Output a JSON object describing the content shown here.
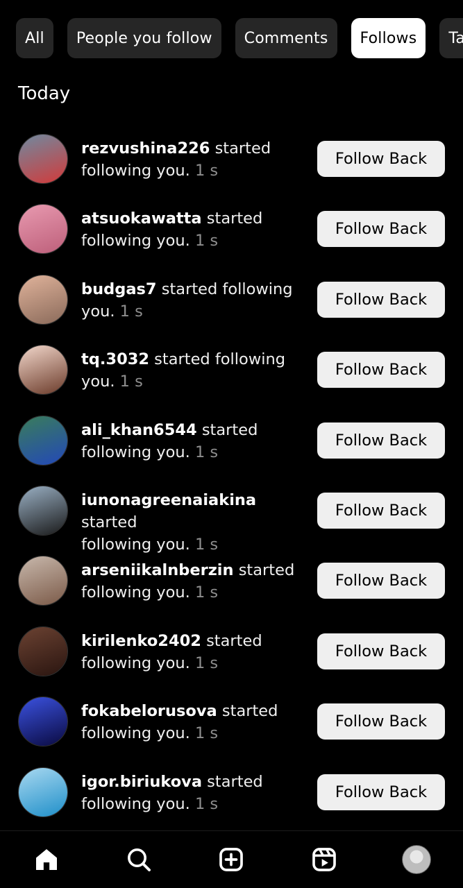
{
  "filters": [
    "All",
    "People you follow",
    "Comments",
    "Follows",
    "Ta"
  ],
  "active_filter_index": 3,
  "section": {
    "title": "Today"
  },
  "items": [
    {
      "username": "rezvushina226",
      "line1_rest": " started",
      "line2": "following you.",
      "time": " 1 s",
      "button": "Follow Back",
      "avatar_colors": [
        "#6f8aa0",
        "#d23a3a"
      ]
    },
    {
      "username": "atsuokawatta",
      "line1_rest": " started",
      "line2": "following you.",
      "time": " 1 s",
      "button": "Follow Back",
      "avatar_colors": [
        "#e89ab0",
        "#bd5f7a"
      ]
    },
    {
      "username": "budgas7",
      "line1_rest": " started following",
      "line2": "you.",
      "time": " 1 s",
      "button": "Follow Back",
      "avatar_colors": [
        "#e0b39b",
        "#8a6a5a"
      ]
    },
    {
      "username": "tq.3032",
      "line1_rest": " started following",
      "line2": "you.",
      "time": " 1 s",
      "button": "Follow Back",
      "avatar_colors": [
        "#f2d7cb",
        "#6b3b2a"
      ]
    },
    {
      "username": "ali_khan6544",
      "line1_rest": " started",
      "line2": "following you.",
      "time": " 1 s",
      "button": "Follow Back",
      "avatar_colors": [
        "#3a7d5a",
        "#2348b8"
      ]
    },
    {
      "username": "iunonagreenaiakina",
      "line1_rest": " started",
      "line2": "following you.",
      "time": " 1 s",
      "button": "Follow Back",
      "avatar_colors": [
        "#9ab0c4",
        "#1a1a1a"
      ]
    },
    {
      "username": "arseniikalnberzin",
      "line1_rest": " started",
      "line2": "following you.",
      "time": " 1 s",
      "button": "Follow Back",
      "avatar_colors": [
        "#c8b8ac",
        "#7b5a48"
      ]
    },
    {
      "username": "kirilenko2402",
      "line1_rest": " started",
      "line2": "following you.",
      "time": " 1 s",
      "button": "Follow Back",
      "avatar_colors": [
        "#6b4232",
        "#2a1510"
      ]
    },
    {
      "username": "fokabelorusova",
      "line1_rest": " started",
      "line2": "following you.",
      "time": " 1 s",
      "button": "Follow Back",
      "avatar_colors": [
        "#3b52e0",
        "#0a0a40"
      ]
    },
    {
      "username": "igor.biriukova",
      "line1_rest": " started",
      "line2": "following you.",
      "time": " 1 s",
      "button": "Follow Back",
      "avatar_colors": [
        "#a8d8f0",
        "#1f8fc9"
      ]
    }
  ],
  "nav": {
    "icons": [
      "home-icon",
      "search-icon",
      "create-icon",
      "reels-icon",
      "profile-avatar"
    ]
  }
}
